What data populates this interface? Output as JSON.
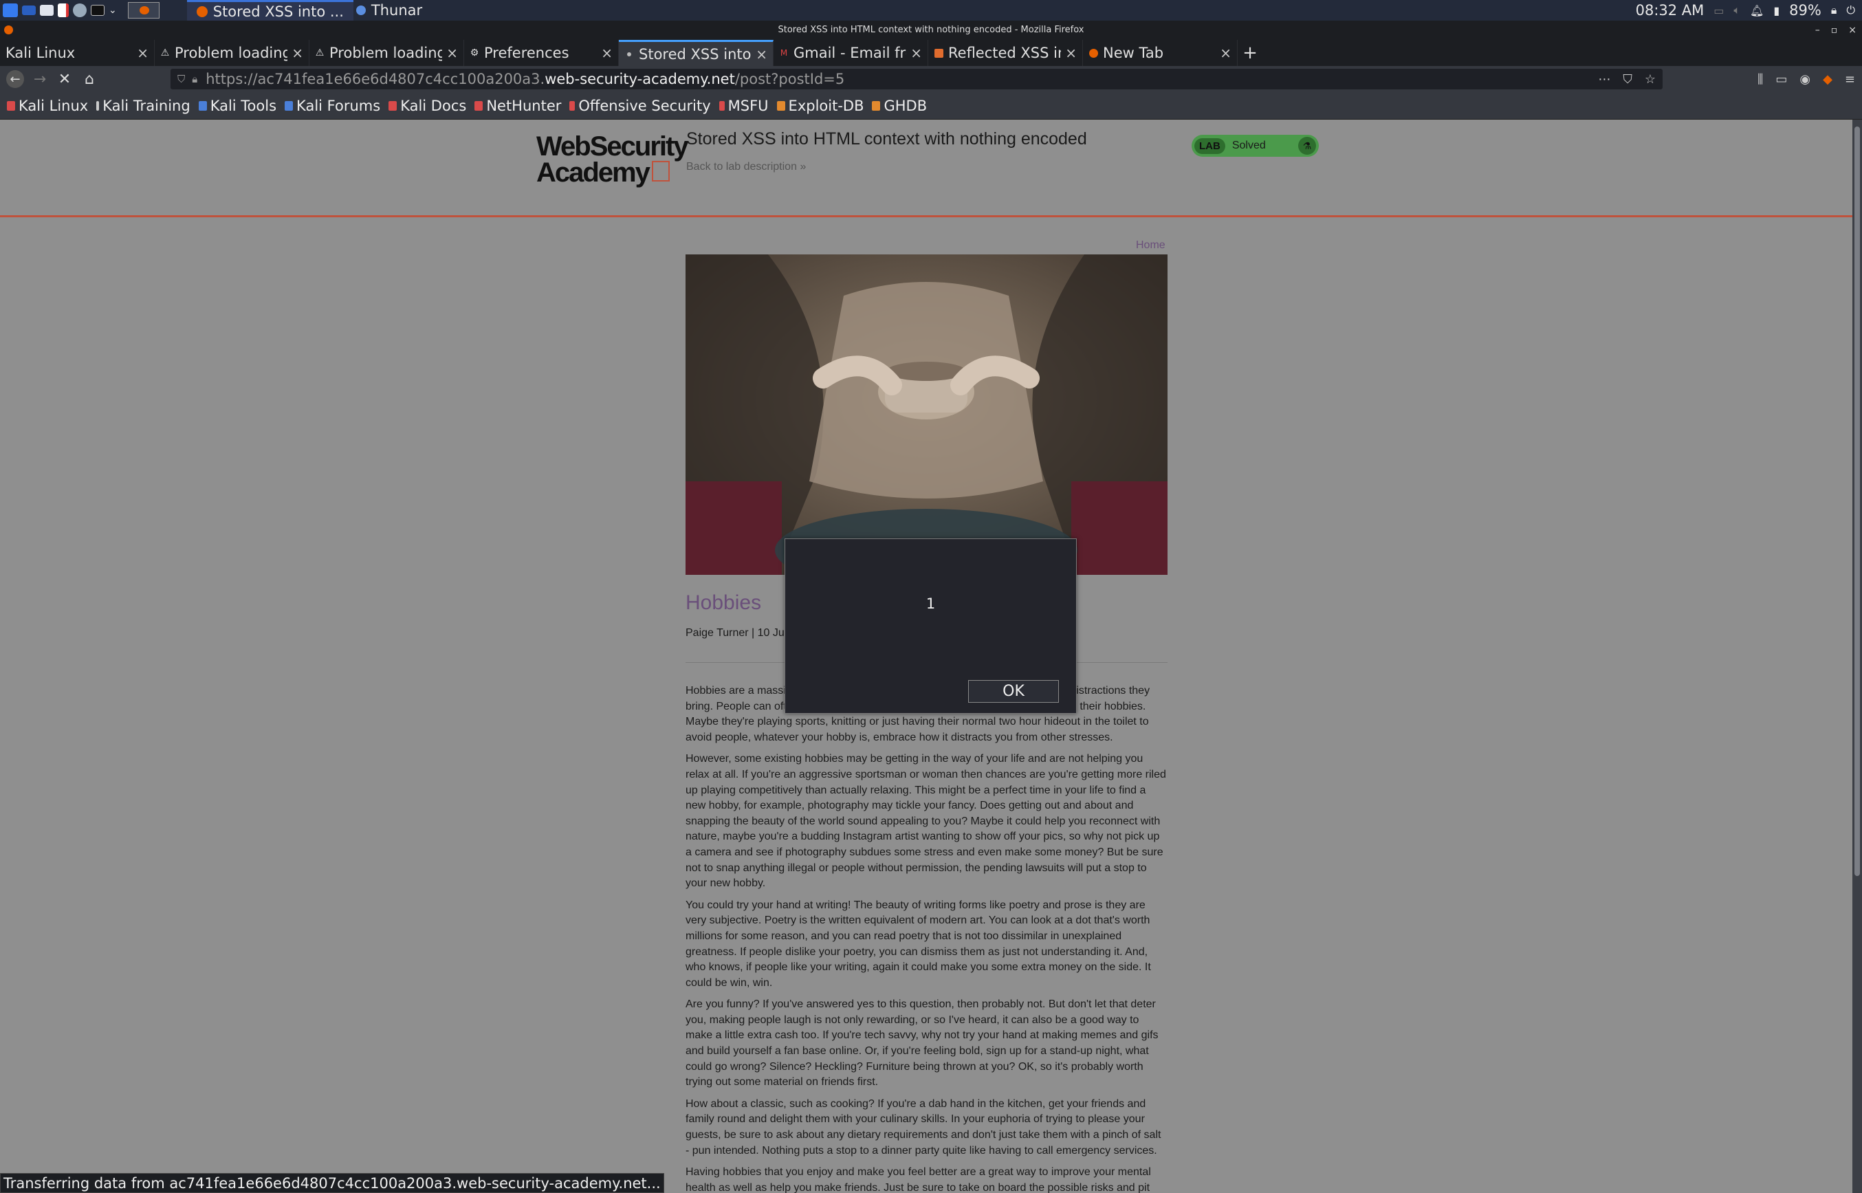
{
  "panel": {
    "task_firefox": "Stored XSS into ...",
    "task_thunar": "Thunar",
    "clock": "08:32 AM",
    "battery": "89%"
  },
  "window": {
    "title": "Stored XSS into HTML context with nothing encoded - Mozilla Firefox"
  },
  "tabs": [
    {
      "label": "Kali Linux",
      "icon": "kali-icon"
    },
    {
      "label": "Problem loading",
      "icon": "warning-icon"
    },
    {
      "label": "Problem loading",
      "icon": "warning-icon"
    },
    {
      "label": "Preferences",
      "icon": "gear-icon"
    },
    {
      "label": "Stored XSS into H",
      "icon": "portswigger-icon"
    },
    {
      "label": "Gmail - Email fro",
      "icon": "gmail-icon"
    },
    {
      "label": "Reflected XSS in",
      "icon": "portswigger-icon"
    },
    {
      "label": "New Tab",
      "icon": "firefox-icon"
    }
  ],
  "nav": {
    "url_prefix": "https://ac741fea1e66e6d4807c4cc100a200a3.",
    "url_domain": "web-security-academy.net",
    "url_path": "/post?postId=5"
  },
  "bookmarks": [
    {
      "label": "Kali Linux",
      "color": "#d94a4a"
    },
    {
      "label": "Kali Training",
      "color": "#cccccc"
    },
    {
      "label": "Kali Tools",
      "color": "#4a7fd9"
    },
    {
      "label": "Kali Forums",
      "color": "#4a7fd9"
    },
    {
      "label": "Kali Docs",
      "color": "#d94a4a"
    },
    {
      "label": "NetHunter",
      "color": "#d94a4a"
    },
    {
      "label": "Offensive Security",
      "color": "#d94a4a"
    },
    {
      "label": "MSFU",
      "color": "#d94a4a"
    },
    {
      "label": "Exploit-DB",
      "color": "#e38a2e"
    },
    {
      "label": "GHDB",
      "color": "#e38a2e"
    }
  ],
  "academy": {
    "logo_line1": "WebSecurity",
    "logo_line2": "Academy",
    "lab_title": "Stored XSS into HTML context with nothing encoded",
    "back_link": "Back to lab description",
    "status_tag": "LAB",
    "status_text": "Solved"
  },
  "post": {
    "home": "Home",
    "title": "Hobbies",
    "meta": "Paige Turner | 10 June 2021",
    "paragraphs": [
      "Hobbies are a massive benefit to people in this day and age, mainly due to the distractions they bring. People can often switch off from work, stress and family for the duration of their hobbies. Maybe they're playing sports, knitting or just having their normal two hour hideout in the toilet to avoid people, whatever your hobby is, embrace how it distracts you from other stresses.",
      "However, some existing hobbies may be getting in the way of your life and are not helping you relax at all. If you're an aggressive sportsman or woman then chances are you're getting more riled up playing competitively than actually relaxing. This might be a perfect time in your life to find a new hobby, for example, photography may tickle your fancy. Does getting out and about and snapping the beauty of the world sound appealing to you? Maybe it could help you reconnect with nature, maybe you're a budding Instagram artist wanting to show off your pics, so why not pick up a camera and see if photography subdues some stress and even make some money? But be sure not to snap anything illegal or people without permission, the pending lawsuits will put a stop to your new hobby.",
      "You could try your hand at writing! The beauty of writing forms like poetry and prose is they are very subjective. Poetry is the written equivalent of modern art. You can look at a dot that's worth millions for some reason, and you can read poetry that is not too dissimilar in unexplained greatness. If people dislike your poetry, you can dismiss them as just not understanding it. And, who knows, if people like your writing, again it could make you some extra money on the side. It could be win, win.",
      "Are you funny? If you've answered yes to this question, then probably not. But don't let that deter you, making people laugh is not only rewarding, or so I've heard, it can also be a good way to make a little extra cash too. If you're tech savvy, why not try your hand at making memes and gifs and build yourself a fan base online. Or, if you're feeling bold, sign up for a stand-up night, what could go wrong? Silence? Heckling? Furniture being thrown at you? OK, so it's probably worth trying out some material on friends first.",
      "How about a classic, such as cooking? If you're a dab hand in the kitchen, get your friends and family round and delight them with your culinary skills. In your euphoria of trying to please your guests, be sure to ask about any dietary requirements and don't just take them with a pinch of salt - pun intended. Nothing puts a stop to a dinner party quite like having to call emergency services.",
      "Having hobbies that you enjoy and make you feel better are a great way to improve your mental health as well as help you make friends. Just be sure to take on board the possible risks and pit"
    ]
  },
  "alert": {
    "message": "1",
    "ok": "OK"
  },
  "statusbar": "Transferring data from ac741fea1e66e6d4807c4cc100a200a3.web-security-academy.net..."
}
